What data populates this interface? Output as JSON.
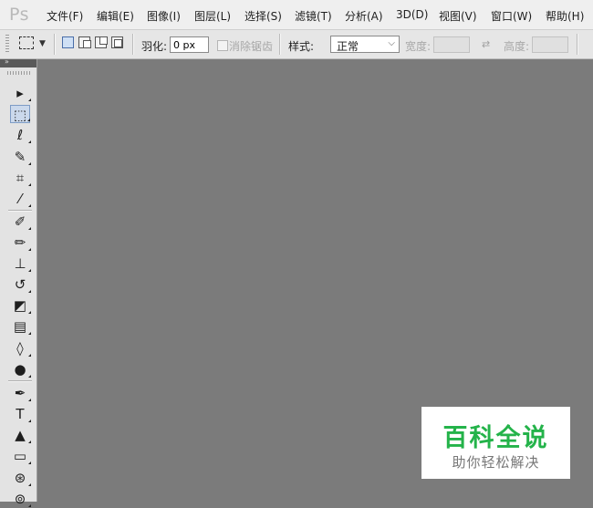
{
  "app": {
    "logo": "Ps"
  },
  "menu": [
    {
      "label": "文件(F)"
    },
    {
      "label": "编辑(E)"
    },
    {
      "label": "图像(I)"
    },
    {
      "label": "图层(L)"
    },
    {
      "label": "选择(S)"
    },
    {
      "label": "滤镜(T)"
    },
    {
      "label": "分析(A)"
    },
    {
      "label": "3D(D)"
    },
    {
      "label": "视图(V)"
    },
    {
      "label": "窗口(W)"
    },
    {
      "label": "帮助(H)"
    }
  ],
  "options": {
    "feather_label": "羽化:",
    "feather_value": "0 px",
    "antialias_label": "消除锯齿",
    "style_label": "样式:",
    "style_value": "正常",
    "width_label": "宽度:",
    "height_label": "高度:"
  },
  "tools": [
    {
      "name": "move-tool",
      "glyph": "▸"
    },
    {
      "name": "rectangular-marquee-tool",
      "glyph": "⬚",
      "selected": true
    },
    {
      "name": "lasso-tool",
      "glyph": "ℓ"
    },
    {
      "name": "quick-selection-tool",
      "glyph": "✎"
    },
    {
      "name": "crop-tool",
      "glyph": "⌗"
    },
    {
      "name": "eyedropper-tool",
      "glyph": "⁄"
    },
    {
      "name": "spot-healing-brush-tool",
      "glyph": "✐"
    },
    {
      "name": "brush-tool",
      "glyph": "✏"
    },
    {
      "name": "clone-stamp-tool",
      "glyph": "⊥"
    },
    {
      "name": "history-brush-tool",
      "glyph": "↺"
    },
    {
      "name": "eraser-tool",
      "glyph": "◩"
    },
    {
      "name": "gradient-tool",
      "glyph": "▤"
    },
    {
      "name": "blur-tool",
      "glyph": "◊"
    },
    {
      "name": "dodge-tool",
      "glyph": "●"
    },
    {
      "name": "pen-tool",
      "glyph": "✒"
    },
    {
      "name": "type-tool",
      "glyph": "T"
    },
    {
      "name": "path-selection-tool",
      "glyph": "▲"
    },
    {
      "name": "rectangle-shape-tool",
      "glyph": "▭"
    },
    {
      "name": "3d-rotate-tool",
      "glyph": "⊛"
    },
    {
      "name": "3d-orbit-tool",
      "glyph": "⊚"
    }
  ],
  "watermark": {
    "title": "百科全说",
    "subtitle": "助你轻松解决"
  },
  "colors": {
    "canvas": "#7b7b7b",
    "watermark_green": "#24b34a"
  }
}
